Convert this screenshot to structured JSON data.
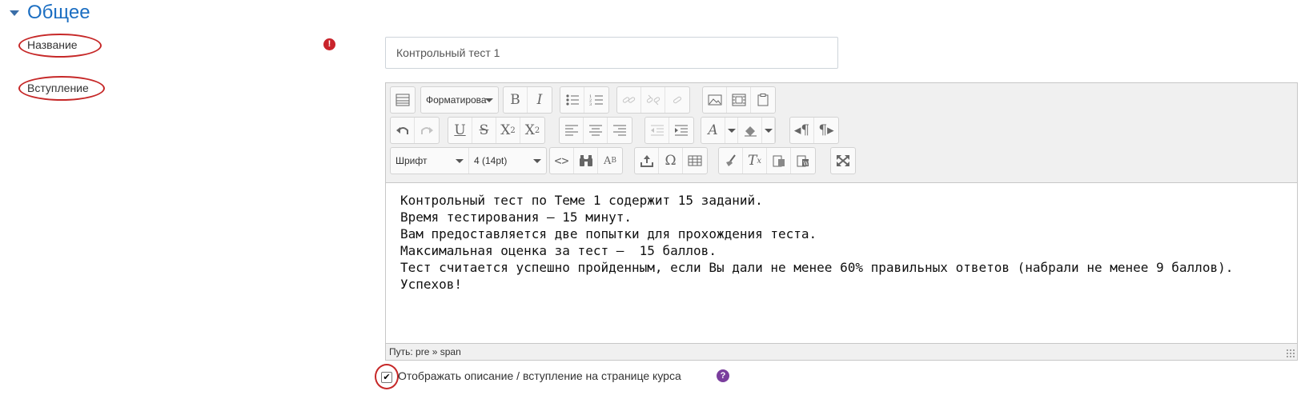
{
  "section": {
    "title": "Общее"
  },
  "fields": {
    "name_label": "Название",
    "intro_label": "Вступление",
    "required_icon": "exclamation-icon",
    "name_value": "Контрольный тест 1"
  },
  "toolbar": {
    "format_label": "Форматирова",
    "font_label": "Шрифт",
    "size_label": "4 (14pt)"
  },
  "editor": {
    "lines": [
      "Контрольный тест по Теме 1 содержит 15 заданий.",
      "Время тестирования — 15 минут.",
      "Вам предоставляется две попытки для прохождения теста.",
      "Максимальная оценка за тест —  15 баллов.",
      "Тест считается успешно пройденным, если Вы дали не менее 60% правильных ответов (набрали не менее 9 баллов).",
      "Успехов!"
    ],
    "path": "Путь: pre » span"
  },
  "display_option": {
    "label": "Отображать описание / вступление на странице курса",
    "checked": true,
    "help_icon": "question-icon"
  },
  "colors": {
    "section_title": "#1b6ec2",
    "annotation_circle": "#c62828",
    "required": "#c9232b",
    "help": "#7a3e9d"
  }
}
